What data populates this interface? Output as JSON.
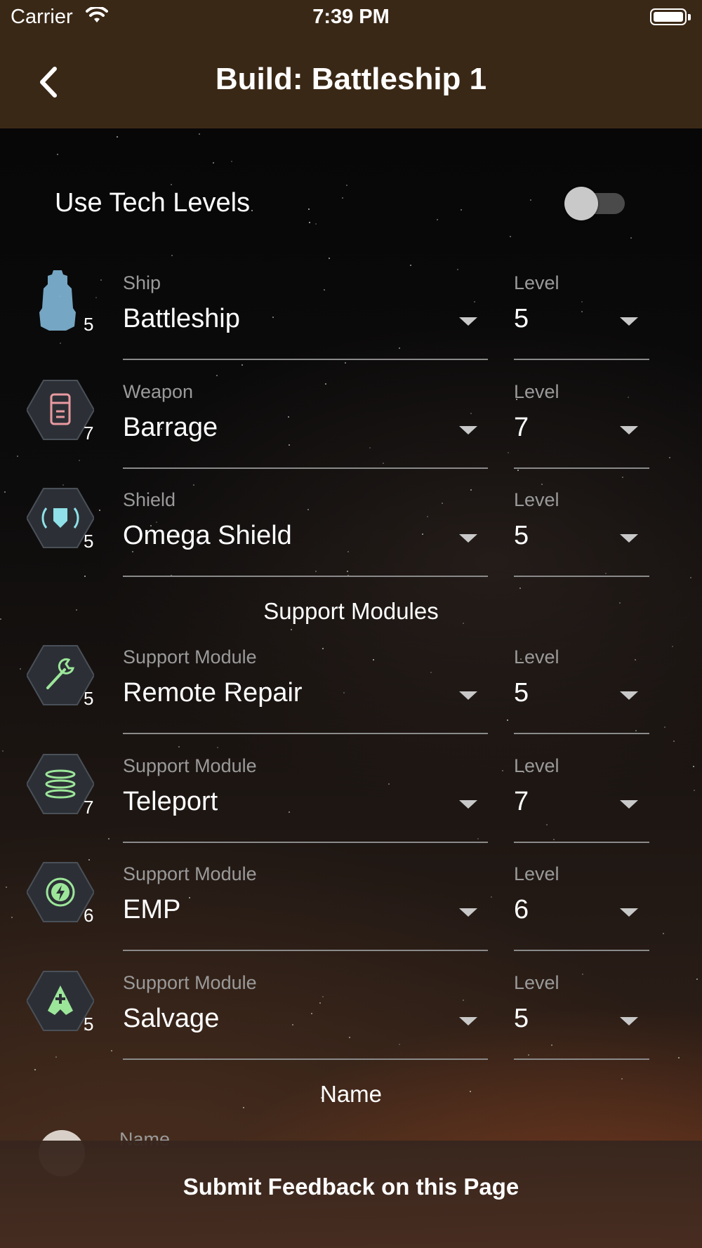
{
  "status_bar": {
    "carrier": "Carrier",
    "time": "7:39 PM"
  },
  "nav": {
    "title": "Build: Battleship 1"
  },
  "tech_levels": {
    "label": "Use Tech Levels",
    "enabled": false
  },
  "rows": [
    {
      "field_label": "Ship",
      "value": "Battleship",
      "level_label": "Level",
      "level": "5",
      "icon_level": "5",
      "icon": "battleship-icon"
    },
    {
      "field_label": "Weapon",
      "value": "Barrage",
      "level_label": "Level",
      "level": "7",
      "icon_level": "7",
      "icon": "barrage-icon"
    },
    {
      "field_label": "Shield",
      "value": "Omega Shield",
      "level_label": "Level",
      "level": "5",
      "icon_level": "5",
      "icon": "shield-icon"
    },
    {
      "field_label": "Support Module",
      "value": "Remote Repair",
      "level_label": "Level",
      "level": "5",
      "icon_level": "5",
      "icon": "wrench-icon"
    },
    {
      "field_label": "Support Module",
      "value": "Teleport",
      "level_label": "Level",
      "level": "7",
      "icon_level": "7",
      "icon": "teleport-icon"
    },
    {
      "field_label": "Support Module",
      "value": "EMP",
      "level_label": "Level",
      "level": "6",
      "icon_level": "6",
      "icon": "emp-icon"
    },
    {
      "field_label": "Support Module",
      "value": "Salvage",
      "level_label": "Level",
      "level": "5",
      "icon_level": "5",
      "icon": "salvage-icon"
    }
  ],
  "sections": {
    "support_modules": "Support Modules",
    "name": "Name"
  },
  "name_field": {
    "label": "Name"
  },
  "footer": {
    "feedback": "Submit Feedback on this Page"
  },
  "colors": {
    "bar": "#3a2816",
    "ship_icon": "#7fb4d4",
    "hex_fill": "#2c3036",
    "green_icon": "#9ce69a",
    "weapon_icon": "#e89aa0"
  }
}
